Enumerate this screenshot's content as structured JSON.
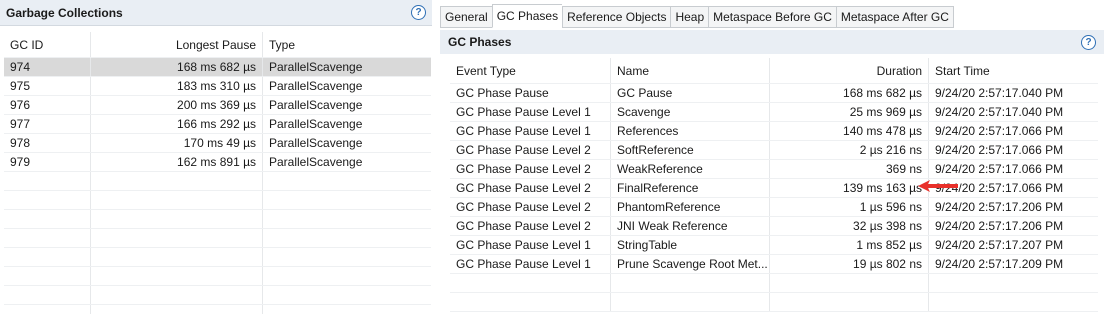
{
  "left": {
    "title": "Garbage Collections",
    "help_label": "?",
    "columns": [
      "GC ID",
      "Longest Pause",
      "Type"
    ],
    "rows": [
      {
        "id": "974",
        "pause": "168 ms 682 µs",
        "type": "ParallelScavenge"
      },
      {
        "id": "975",
        "pause": "183 ms 310 µs",
        "type": "ParallelScavenge"
      },
      {
        "id": "976",
        "pause": "200 ms 369 µs",
        "type": "ParallelScavenge"
      },
      {
        "id": "977",
        "pause": "166 ms 292 µs",
        "type": "ParallelScavenge"
      },
      {
        "id": "978",
        "pause": "170 ms 49 µs",
        "type": "ParallelScavenge"
      },
      {
        "id": "979",
        "pause": "162 ms 891 µs",
        "type": "ParallelScavenge"
      }
    ]
  },
  "tabs": [
    "General",
    "GC Phases",
    "Reference Objects",
    "Heap",
    "Metaspace Before GC",
    "Metaspace After GC"
  ],
  "active_tab": "GC Phases",
  "phases": {
    "title": "GC Phases",
    "help_label": "?",
    "columns": [
      "Event Type",
      "Name",
      "Duration",
      "Start Time"
    ],
    "rows": [
      {
        "type": "GC Phase Pause",
        "name": "GC Pause",
        "duration": "168 ms 682 µs",
        "start": "9/24/20 2:57:17.040 PM"
      },
      {
        "type": "GC Phase Pause Level 1",
        "name": "Scavenge",
        "duration": "25 ms 969 µs",
        "start": "9/24/20 2:57:17.040 PM"
      },
      {
        "type": "GC Phase Pause Level 1",
        "name": "References",
        "duration": "140 ms 478 µs",
        "start": "9/24/20 2:57:17.066 PM"
      },
      {
        "type": "GC Phase Pause Level 2",
        "name": "SoftReference",
        "duration": "2 µs 216 ns",
        "start": "9/24/20 2:57:17.066 PM"
      },
      {
        "type": "GC Phase Pause Level 2",
        "name": "WeakReference",
        "duration": "369 ns",
        "start": "9/24/20 2:57:17.066 PM"
      },
      {
        "type": "GC Phase Pause Level 2",
        "name": "FinalReference",
        "duration": "139 ms 163 µs",
        "start": "9/24/20 2:57:17.066 PM"
      },
      {
        "type": "GC Phase Pause Level 2",
        "name": "PhantomReference",
        "duration": "1 µs 596 ns",
        "start": "9/24/20 2:57:17.206 PM"
      },
      {
        "type": "GC Phase Pause Level 2",
        "name": "JNI Weak Reference",
        "duration": "32 µs 398 ns",
        "start": "9/24/20 2:57:17.206 PM"
      },
      {
        "type": "GC Phase Pause Level 1",
        "name": "StringTable",
        "duration": "1 ms 852 µs",
        "start": "9/24/20 2:57:17.207 PM"
      },
      {
        "type": "GC Phase Pause Level 1",
        "name": "Prune Scavenge Root Met...",
        "duration": "19 µs 802 ns",
        "start": "9/24/20 2:57:17.209 PM"
      }
    ]
  },
  "colors": {
    "arrow": "#e8302a",
    "header_bg": "#e9eef4",
    "selected_row": "#d9d9d9"
  },
  "icons": {
    "help": "help-icon",
    "annotation": "red-arrow-icon"
  }
}
